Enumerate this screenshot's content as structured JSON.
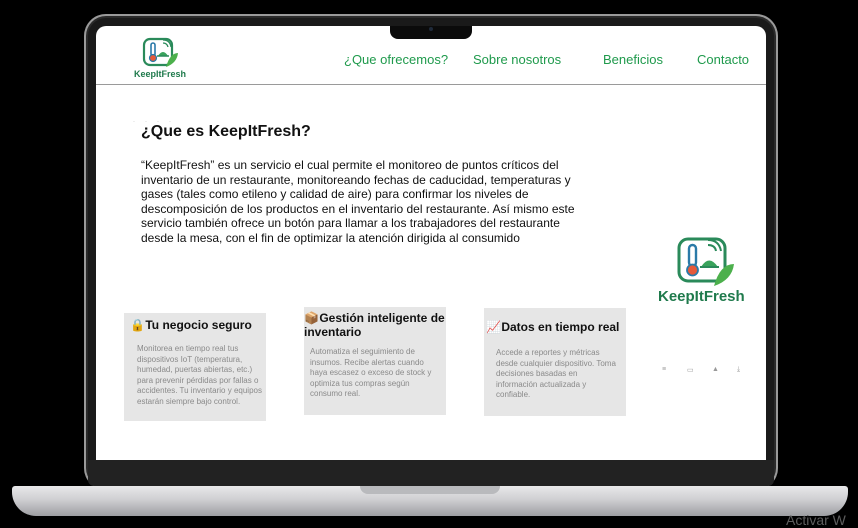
{
  "brand": {
    "name": "KeepItFresh",
    "color": "#1f7a4c",
    "nav_color": "#1f9a4c"
  },
  "nav": [
    {
      "label": "¿Que ofrecemos?"
    },
    {
      "label": "Sobre nosotros"
    },
    {
      "label": "Beneficios"
    },
    {
      "label": "Contacto"
    }
  ],
  "main": {
    "title": "¿Que es KeepItFresh?",
    "description": "“KeepItFresh” es un servicio el cual permite el monitoreo de puntos críticos del inventario de un restaurante, monitoreando fechas de caducidad, temperaturas y gases (tales como etileno y calidad de aire) para confirmar los niveles de descomposición de los productos en el inventario del restaurante. Así mismo este servicio también ofrece un botón para llamar a los trabajadores del restaurante desde la mesa, con el fin de optimizar la atención dirigida al consumido"
  },
  "cards": [
    {
      "icon": "lock-icon",
      "emoji": "🔒",
      "title": "Tu negocio seguro",
      "text": "Monitorea en tiempo real tus dispositivos IoT (temperatura, humedad, puertas abiertas, etc.) para prevenir pérdidas por fallas o accidentes. Tu inventario y equipos estarán siempre bajo control."
    },
    {
      "icon": "package-icon",
      "emoji": "📦",
      "title": "Gestión inteligente de inventario",
      "text": "Automatiza el seguimiento de insumos. Recibe alertas cuando haya escasez o exceso de stock y optimiza tus compras según consumo real."
    },
    {
      "icon": "chart-icon",
      "emoji": "📈",
      "title": "Datos en tiempo real",
      "text": "Accede a reportes y métricas desde cualquier dispositivo. Toma decisiones basadas en información actualizada y confiable."
    }
  ],
  "watermark": "Activar W"
}
